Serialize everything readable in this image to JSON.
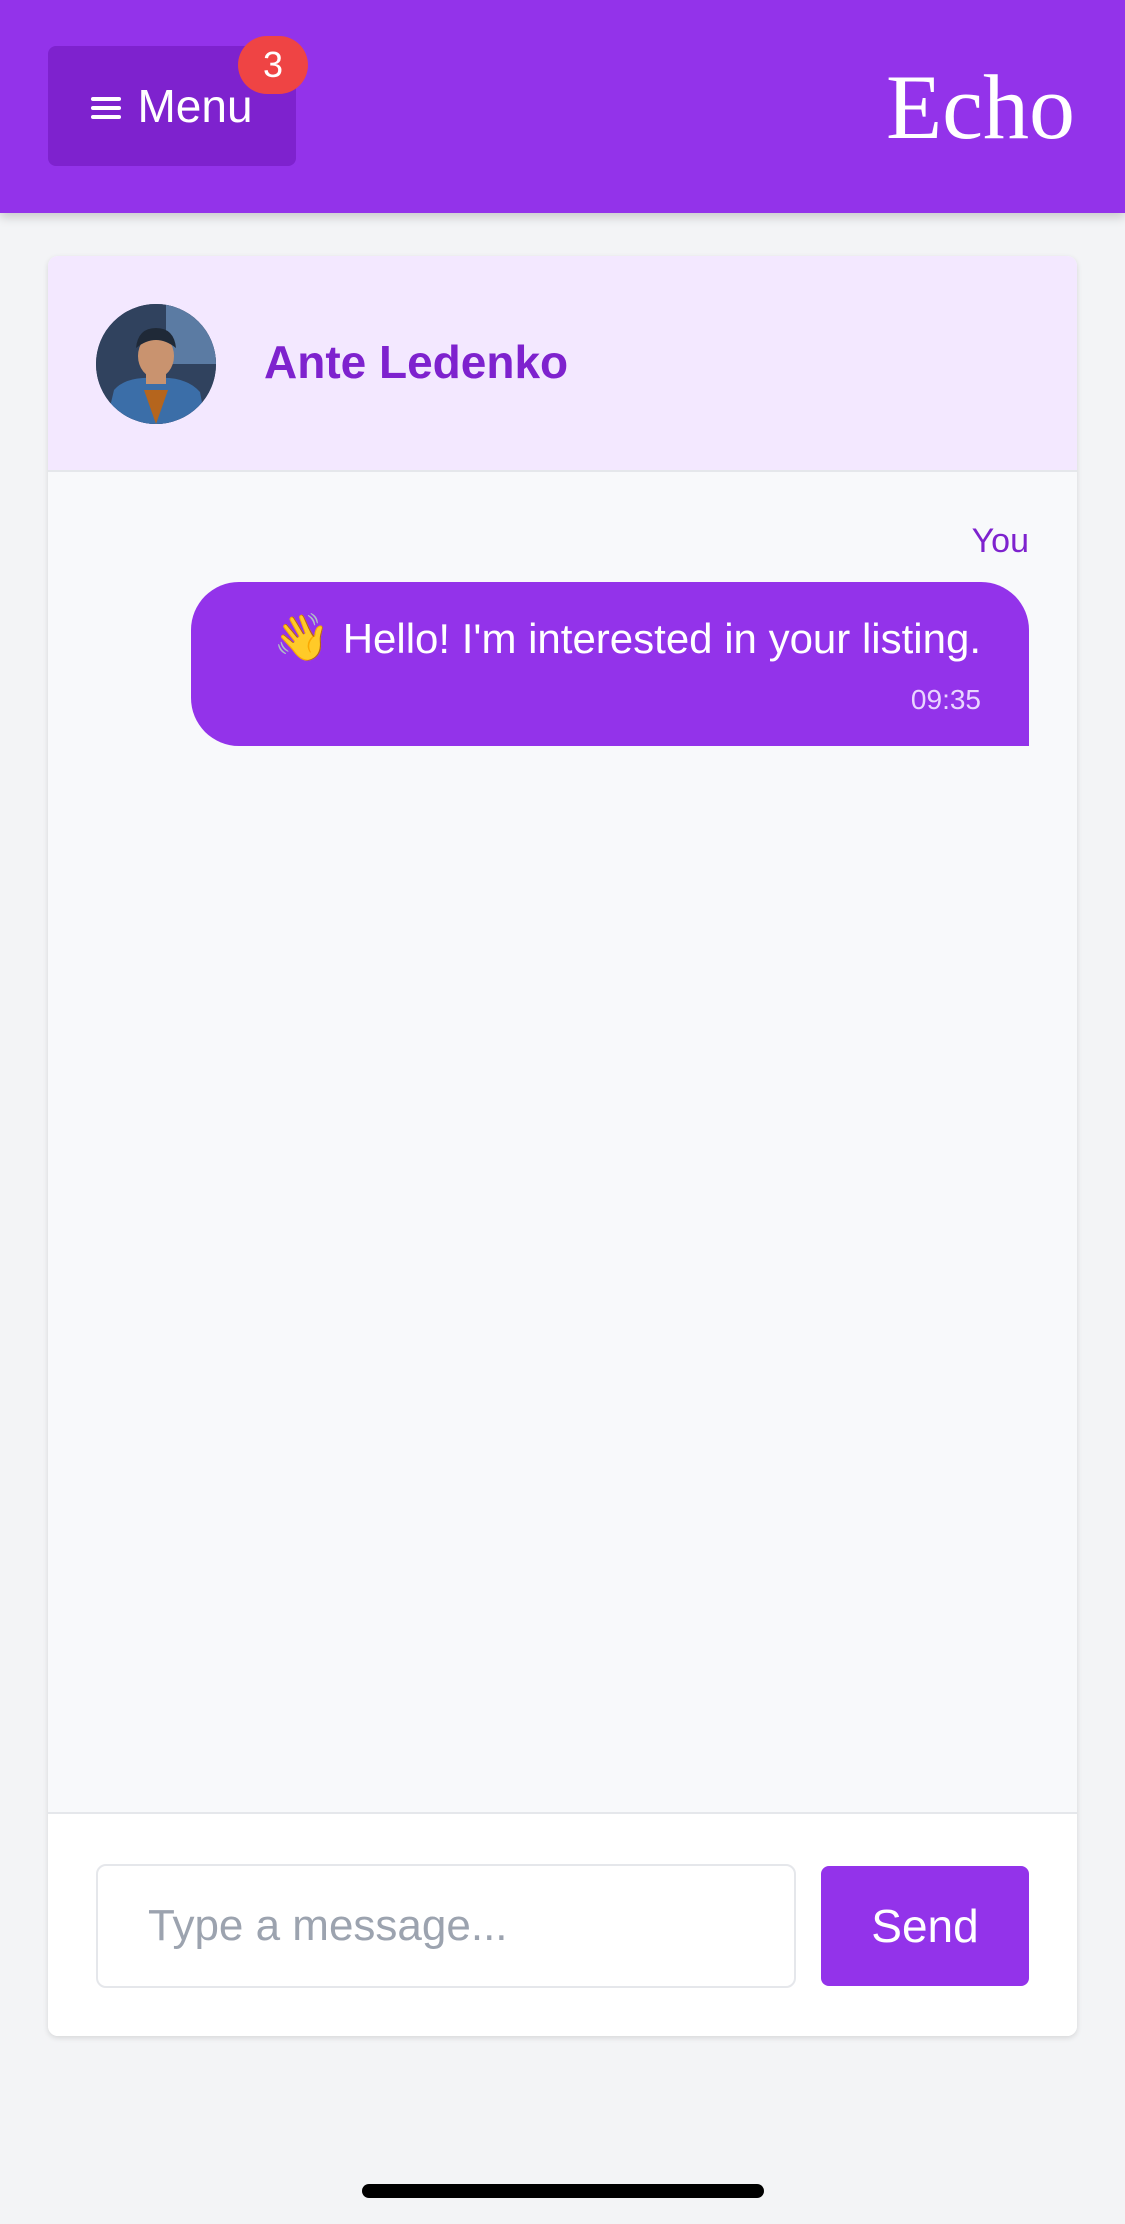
{
  "header": {
    "menu_label": "Menu",
    "menu_icon": "hamburger-icon",
    "notification_count": "3",
    "brand": "Echo",
    "colors": {
      "primary": "#9333ea",
      "primary_dark": "#7e22ce",
      "badge": "#ef4444"
    }
  },
  "chat": {
    "contact_name": "Ante Ledenko",
    "messages": [
      {
        "sender": "You",
        "emoji": "👋",
        "text": "Hello! I'm interested in your listing.",
        "time": "09:35"
      }
    ]
  },
  "composer": {
    "placeholder": "Type a message...",
    "value": "",
    "send_label": "Send"
  }
}
